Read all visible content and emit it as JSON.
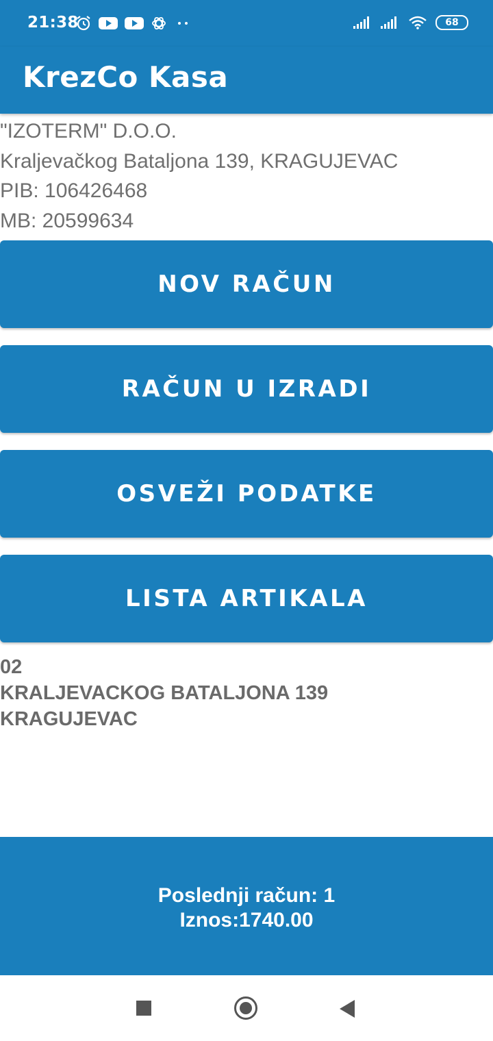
{
  "status_bar": {
    "time": "21:38",
    "battery": "68",
    "icons": [
      "alarm-icon",
      "youtube-icon",
      "youtube-icon",
      "chatgpt-icon",
      "more-dots-icon",
      "signal-icon",
      "signal-icon",
      "wifi-icon",
      "battery-icon"
    ]
  },
  "app_bar": {
    "title": "KrezCo Kasa"
  },
  "company": {
    "name": "\"IZOTERM\" D.O.O.",
    "address": "Kraljevačkog Bataljona 139,  KRAGUJEVAC",
    "pib": "PIB: 106426468",
    "mb": "MB: 20599634"
  },
  "buttons": {
    "new_receipt": "NOV RAČUN",
    "receipt_in_progress": "RAČUN U IZRADI",
    "refresh_data": "OSVEŽI PODATKE",
    "article_list": "LISTA ARTIKALA"
  },
  "store": {
    "code": "02",
    "address": "KRALJEVACKOG BATALJONA 139",
    "city": "KRAGUJEVAC"
  },
  "footer": {
    "last_receipt": "Poslednji račun: 1",
    "amount": "Iznos:1740.00"
  },
  "nav_bar": {
    "icons": [
      "recents-icon",
      "home-icon",
      "back-icon"
    ]
  },
  "colors": {
    "primary": "#1a7fbc",
    "text_gray": "#6f6f6f",
    "white": "#ffffff"
  }
}
